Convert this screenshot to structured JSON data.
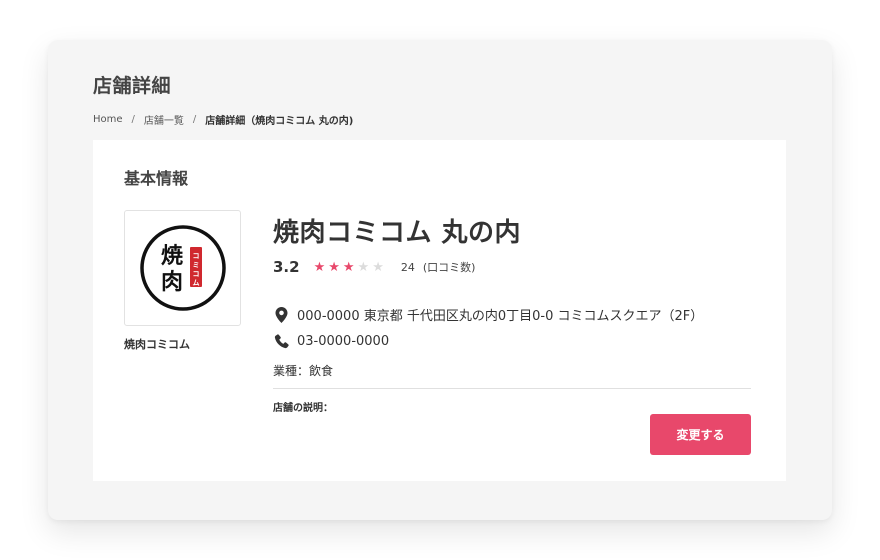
{
  "page": {
    "title": "店舗詳細"
  },
  "breadcrumb": {
    "items": [
      "Home",
      "店舗一覧",
      "店舗詳細（焼肉コミコム 丸の内)"
    ],
    "separator": "/"
  },
  "section": {
    "title": "基本情報"
  },
  "logo": {
    "main_text": "焼肉",
    "badge_text": "コミコム",
    "caption": "焼肉コミコム"
  },
  "store": {
    "name": "焼肉コミコム 丸の内",
    "rating": "3.2",
    "rating_value": 3.2,
    "stars_filled": 3,
    "stars_total": 5,
    "review_count": "24",
    "review_label": "(口コミ数)",
    "address": "000-0000 東京都 千代田区丸の内0丁目0-0 コミコムスクエア（2F）",
    "phone": "03-0000-0000",
    "genre_label": "業種：",
    "genre_value": "飲食",
    "description_label": "店舗の説明："
  },
  "actions": {
    "edit_label": "変更する"
  },
  "icons": {
    "address": "map-pin-icon",
    "phone": "phone-icon",
    "star": "star-icon"
  },
  "colors": {
    "accent": "#e8486b",
    "star_on": "#e8486b",
    "star_off": "#dcdcdc",
    "logo_red": "#d0282e"
  }
}
